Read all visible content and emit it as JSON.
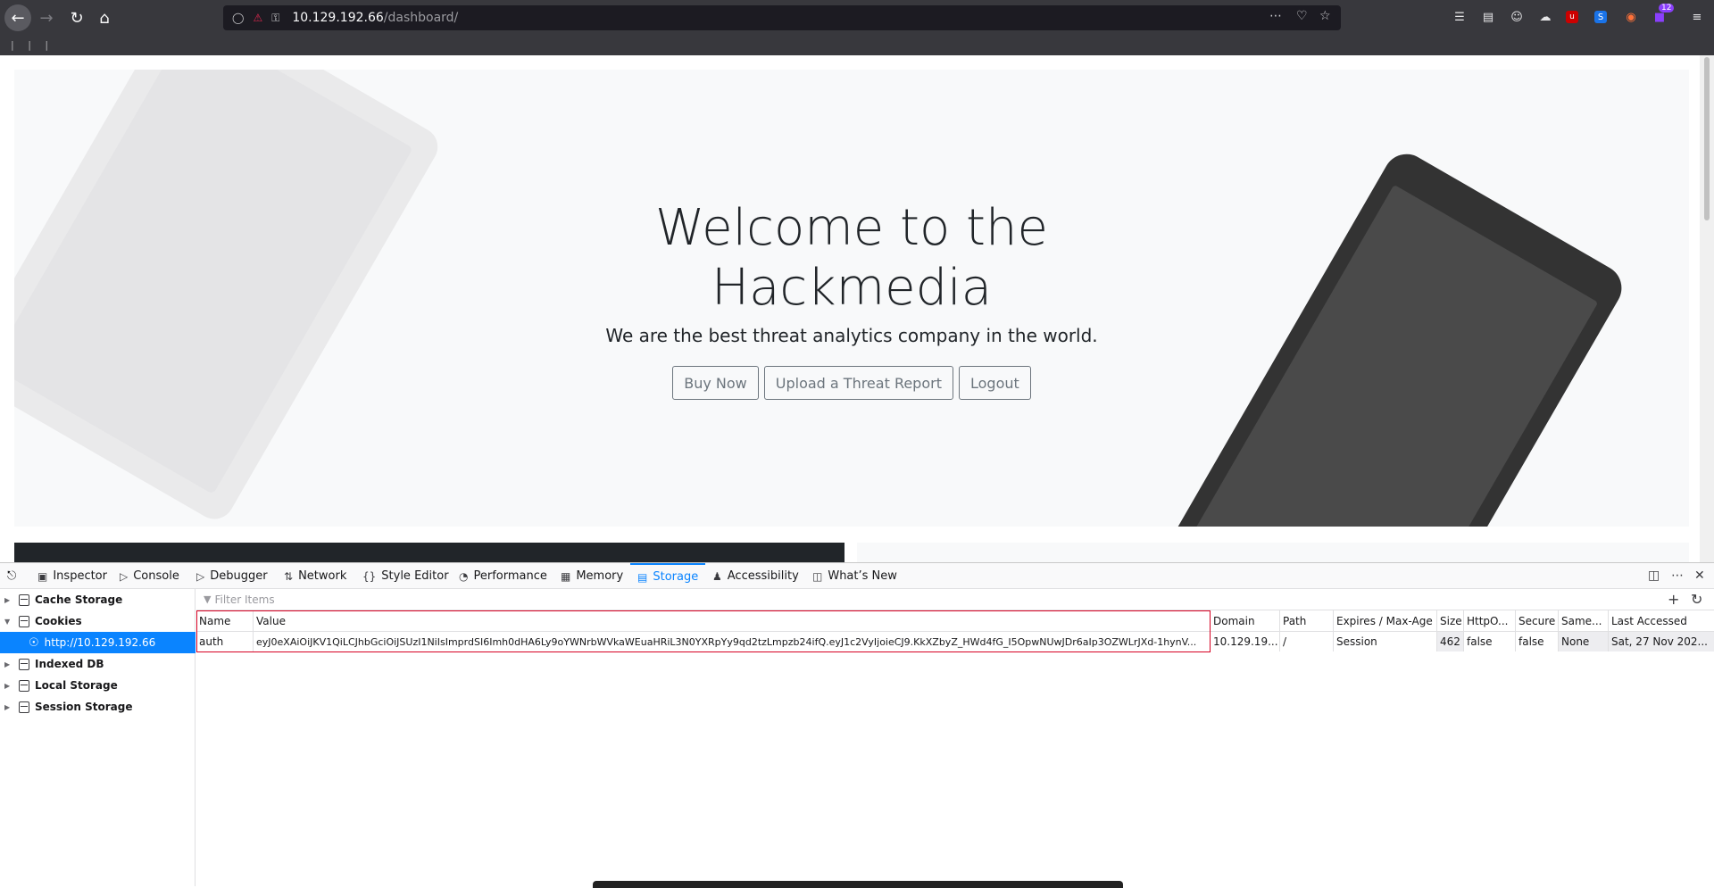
{
  "browser": {
    "url_host": "10.129.192.66",
    "url_path": "/dashboard/",
    "badge_count": "12",
    "bookmarks_text": "| | |"
  },
  "page": {
    "title_line1": "Welcome to the",
    "title_line2": "Hackmedia",
    "subtitle": "We are the best threat analytics company in the world.",
    "buttons": [
      "Buy Now",
      "Upload a Threat Report",
      "Logout"
    ]
  },
  "devtools": {
    "tabs": [
      "Inspector",
      "Console",
      "Debugger",
      "Network",
      "Style Editor",
      "Performance",
      "Memory",
      "Storage",
      "Accessibility",
      "What’s New"
    ],
    "selected_tab": "Storage",
    "sidebar": {
      "items": [
        "Cache Storage",
        "Cookies",
        "http://10.129.192.66",
        "Indexed DB",
        "Local Storage",
        "Session Storage"
      ]
    },
    "filter_placeholder": "Filter Items",
    "columns": [
      "Name",
      "Value",
      "Domain",
      "Path",
      "Expires / Max-Age",
      "Size",
      "HttpO...",
      "Secure",
      "Same...",
      "Last Accessed"
    ],
    "row": {
      "name": "auth",
      "value": "eyJ0eXAiOiJKV1QiLCJhbGciOiJSUzI1NiIsImprdSI6Imh0dHA6Ly9oYWNrbWVkaWEuaHRiL3N0YXRpYy9qd2tzLmpzb24ifQ.eyJ1c2VyIjoieCJ9.KkXZbyZ_HWd4fG_I5OpwNUwJDr6aIp3OZWLrJXd-1hynV...",
      "domain": "10.129.19...",
      "path": "/",
      "expires": "Session",
      "size": "462",
      "httponly": "false",
      "secure": "false",
      "samesite": "None",
      "last_accessed": "Sat, 27 Nov 202..."
    }
  }
}
